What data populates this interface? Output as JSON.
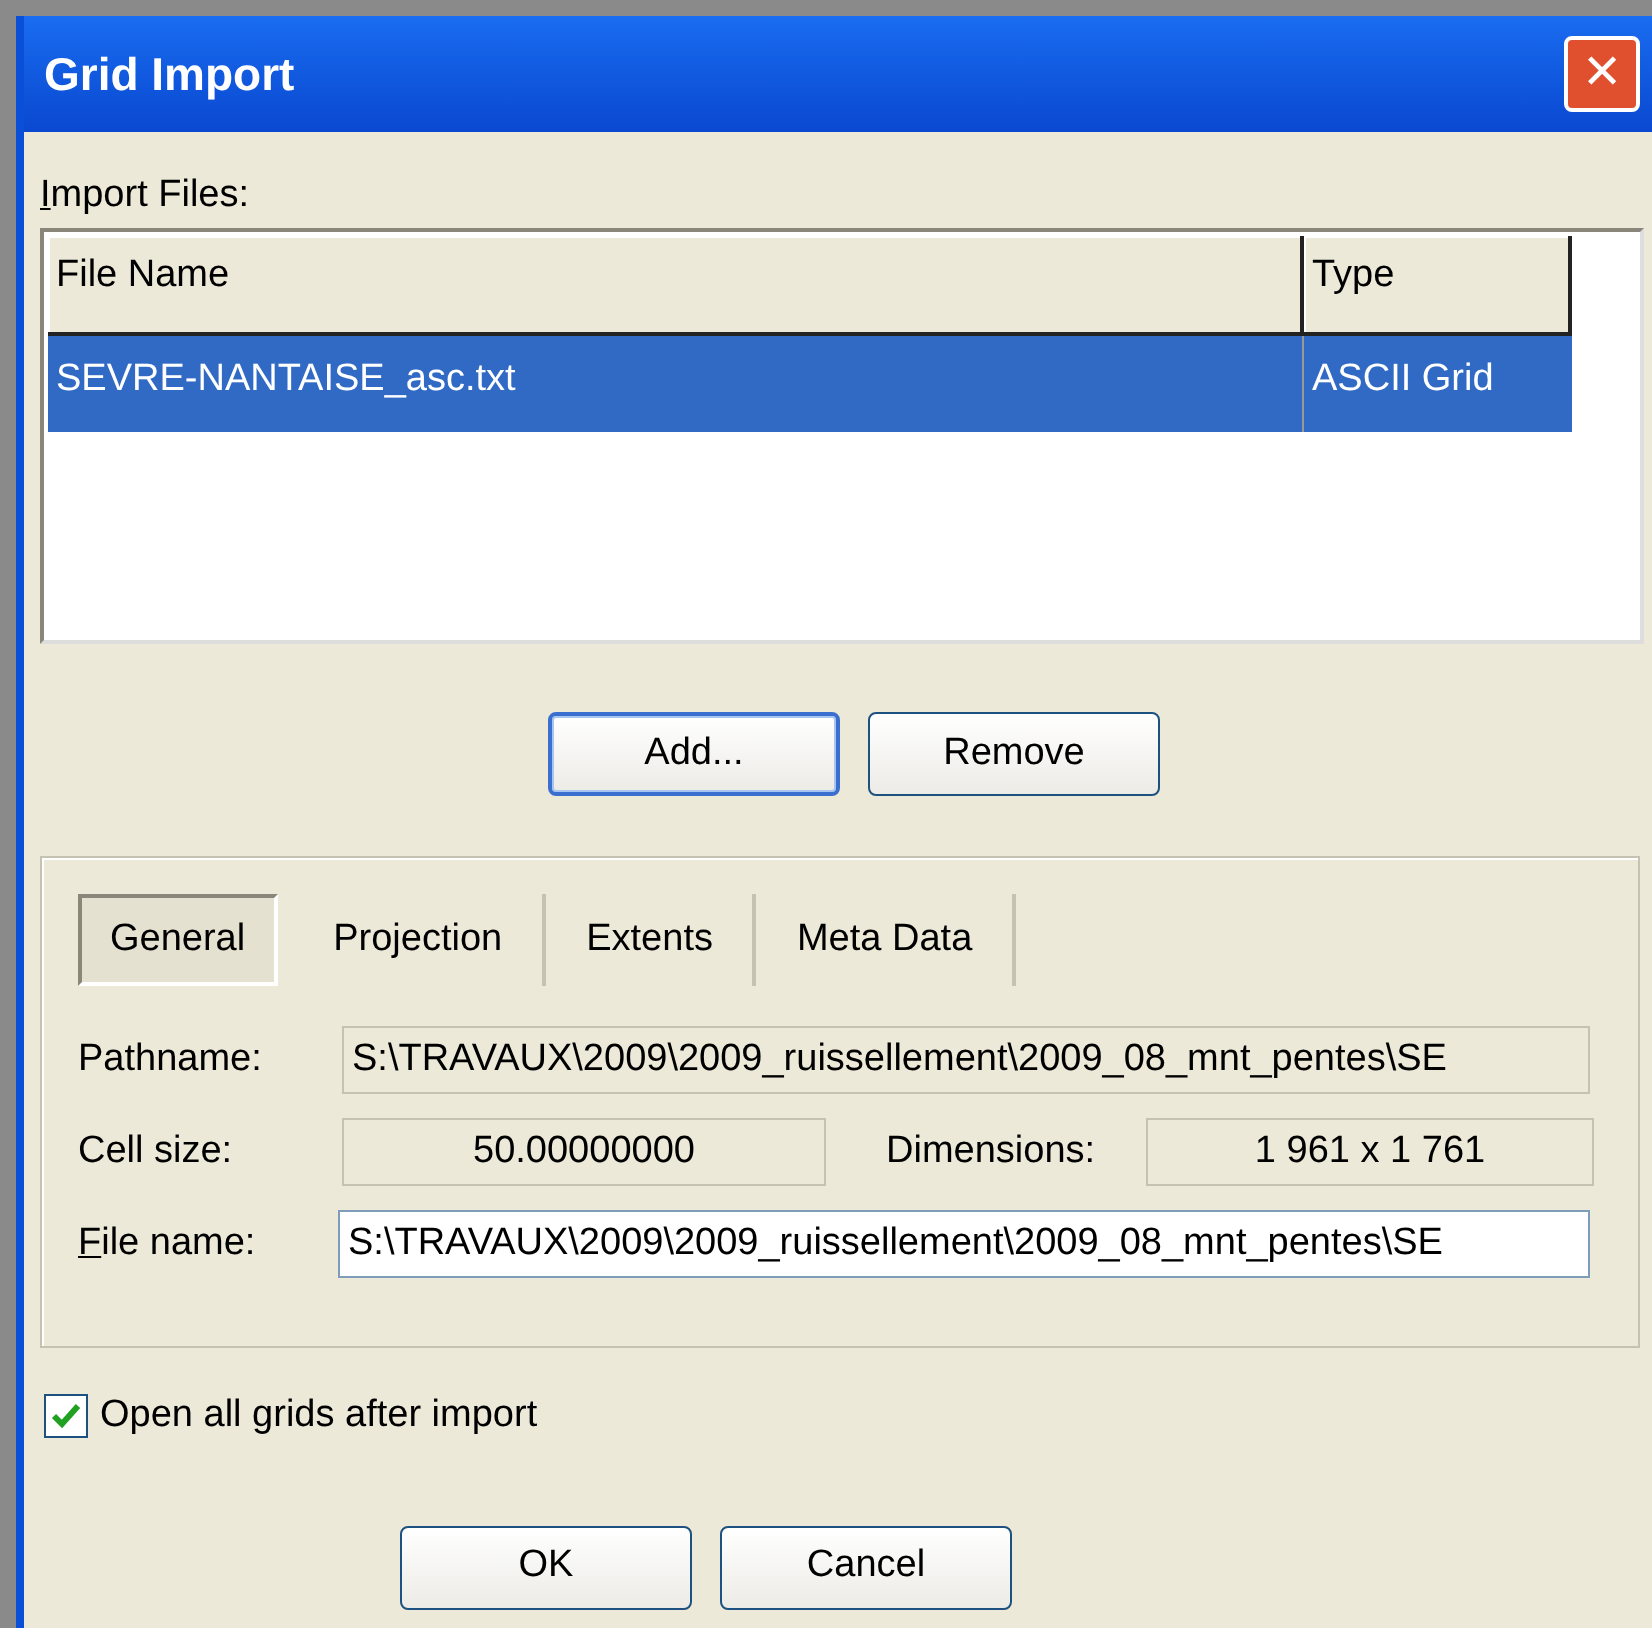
{
  "window": {
    "title": "Grid Import",
    "close": "✕"
  },
  "import_files": {
    "label": "Import Files:",
    "mnemonic_first": true,
    "columns": [
      "File Name",
      "Type"
    ],
    "rows": [
      {
        "cells": [
          "SEVRE-NANTAISE_asc.txt",
          "ASCII Grid"
        ],
        "selected": true
      }
    ]
  },
  "list_buttons": [
    {
      "label": "Add...",
      "focused": true
    },
    {
      "label": "Remove",
      "focused": false
    }
  ],
  "tabs": [
    {
      "label": "General",
      "selected": true
    },
    {
      "label": "Projection",
      "selected": false
    },
    {
      "label": "Extents",
      "selected": false
    },
    {
      "label": "Meta Data",
      "selected": false
    }
  ],
  "general": {
    "pathname": {
      "label": "Pathname:",
      "value": "S:\\TRAVAUX\\2009\\2009_ruissellement\\2009_08_mnt_pentes\\SE"
    },
    "cell_size": {
      "label": "Cell size:",
      "value": "50.00000000"
    },
    "dimensions": {
      "label": "Dimensions:",
      "value": "1 961 x 1 761"
    },
    "file_name": {
      "label": "File name:",
      "mnemonic_first": true,
      "value": "S:\\TRAVAUX\\2009\\2009_ruissellement\\2009_08_mnt_pentes\\SE"
    }
  },
  "open_all": {
    "label": "Open all grids after import",
    "checked": true
  },
  "buttons": [
    {
      "label": "OK"
    },
    {
      "label": "Cancel"
    }
  ]
}
